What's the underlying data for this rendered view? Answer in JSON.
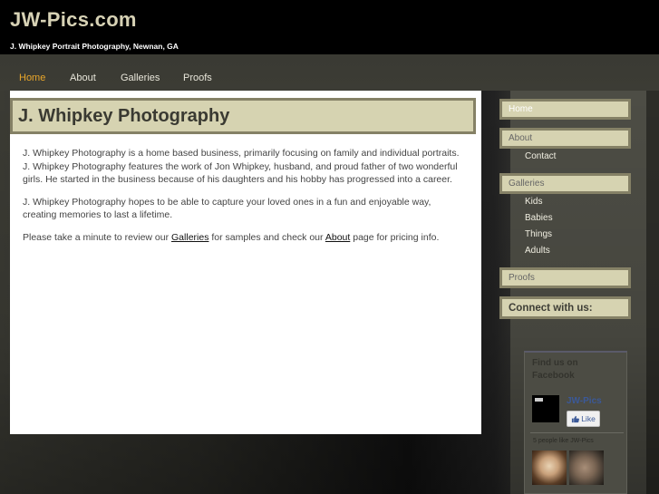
{
  "header": {
    "site_title": "JW-Pics.com",
    "tagline": "J. Whipkey Portrait Photography, Newnan, GA"
  },
  "nav": {
    "items": [
      {
        "label": "Home",
        "active": true
      },
      {
        "label": "About",
        "active": false
      },
      {
        "label": "Galleries",
        "active": false
      },
      {
        "label": "Proofs",
        "active": false
      }
    ]
  },
  "main": {
    "heading": "J. Whipkey Photography",
    "paragraph1": "J. Whipkey Photography is a home based business, primarily focusing on family and individual portraits.  J. Whipkey Photography features the work of Jon Whipkey, husband, and proud father of two wonderful girls.  He started in the business because of his daughters and his hobby has progressed into a career.",
    "paragraph2": "J. Whipkey Photography hopes to be able to capture your loved ones in a fun and enjoyable way, creating memories to last a lifetime.",
    "paragraph3_before": "Please take a minute to review our ",
    "galleries_link": "Galleries",
    "paragraph3_middle": " for samples and check our ",
    "about_link": "About",
    "paragraph3_after": " page for pricing info."
  },
  "sidebar": {
    "home": "Home",
    "about": "About",
    "contact": "Contact",
    "galleries": "Galleries",
    "kids": "Kids",
    "babies": "Babies",
    "things": "Things",
    "adults": "Adults",
    "proofs": "Proofs",
    "connect": "Connect with us:"
  },
  "facebook": {
    "title": "Find us on Facebook",
    "page_name": "JW-Pics",
    "like_label": "Like",
    "likes_text": "5 people like JW-Pics"
  },
  "colors": {
    "accent_active": "#e9a62a",
    "heading_bg": "#d6d3b1",
    "heading_border": "#858166",
    "title_color": "#d7d2b5"
  }
}
